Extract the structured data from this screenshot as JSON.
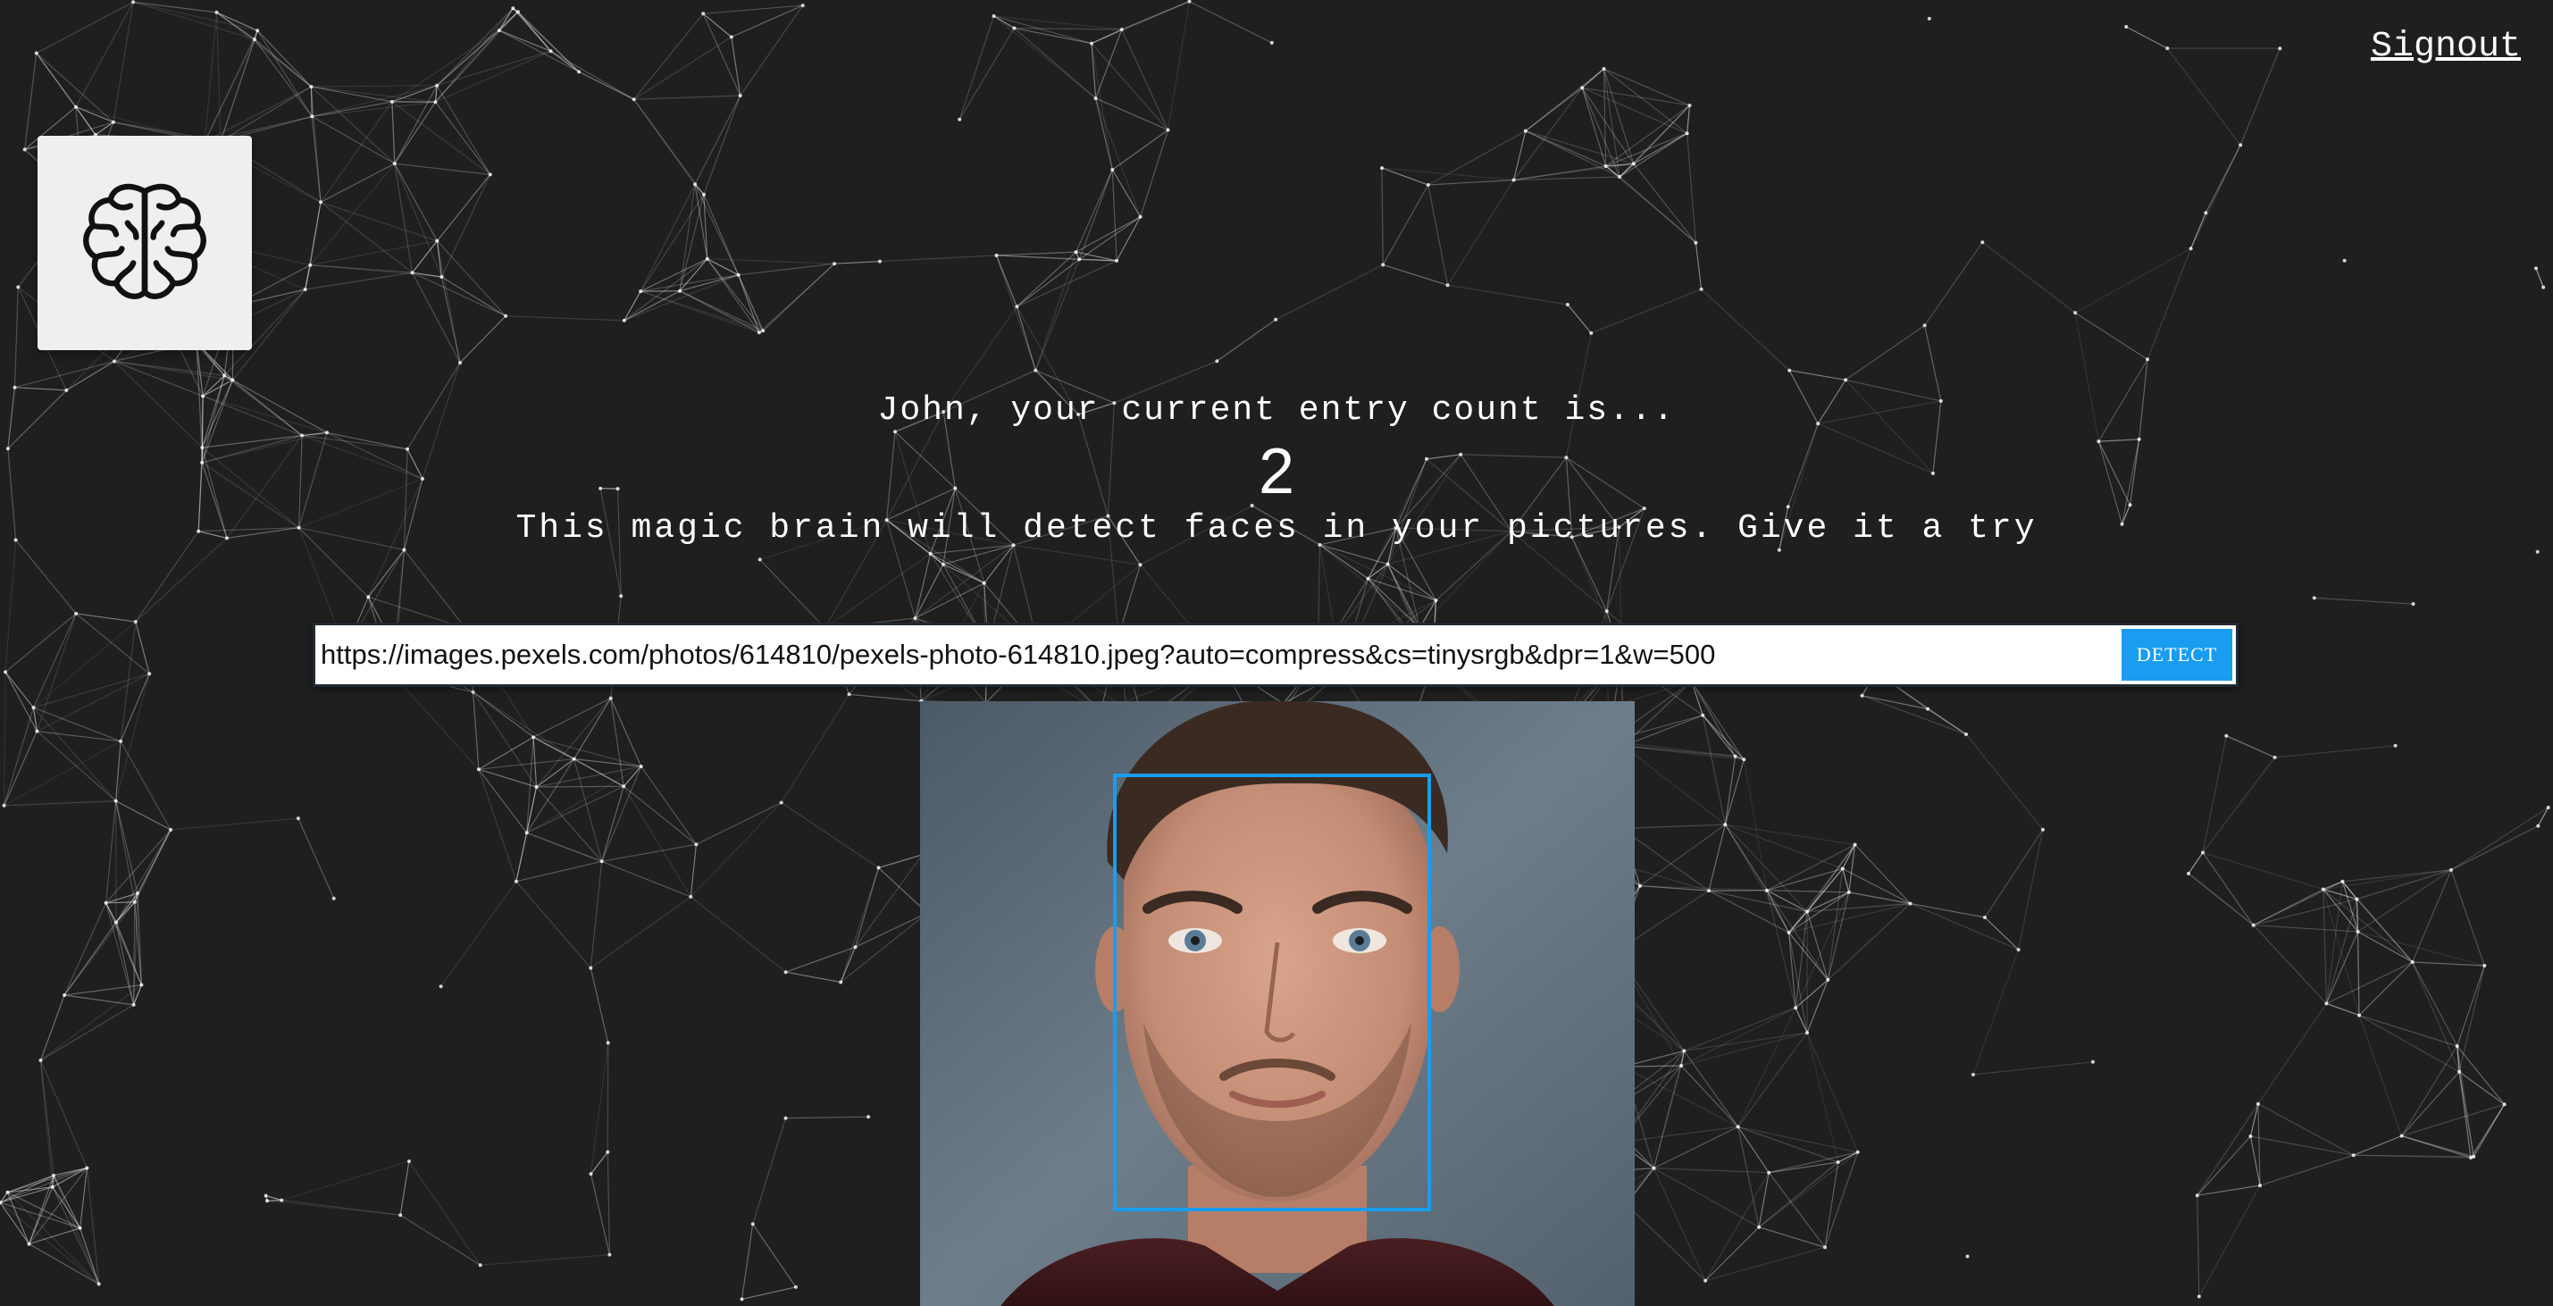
{
  "nav": {
    "signout_label": "Signout"
  },
  "logo": {
    "icon": "brain-icon"
  },
  "rank": {
    "message": "John, your current entry count is...",
    "count": "2"
  },
  "intro": {
    "text": "This magic brain will detect faces in your pictures. Give it a try"
  },
  "form": {
    "url_value": "https://images.pexels.com/photos/614810/pexels-photo-614810.jpeg?auto=compress&cs=tinysrgb&dpr=1&w=500",
    "detect_label": "DETECT"
  },
  "colors": {
    "background": "#1f1f1f",
    "accent": "#1a9cf0",
    "logo_card": "#efefef"
  }
}
